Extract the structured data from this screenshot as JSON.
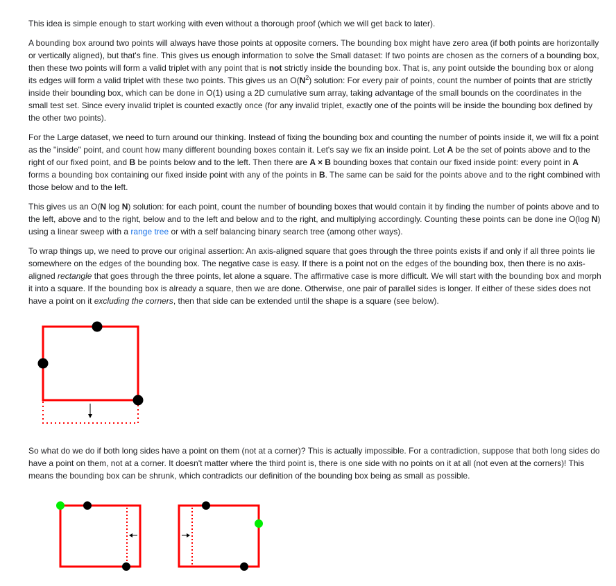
{
  "intro": "This idea is simple enough to start working with even without a thorough proof (which we will get back to later).",
  "p2": {
    "a": "A bounding box around two points will always have those points at opposite corners. The bounding box might have zero area (if both points are horizontally or vertically aligned), but that's fine. This gives us enough information to solve the Small dataset: If two points are chosen as the corners of a bounding box, then these two points will form a valid triplet with any point that is ",
    "bold_not": "not",
    "b": " strictly inside the bounding box. That is, any point outside the bounding box or along its edges will form a valid triplet with these two points. This gives us an O(",
    "bold_n": "N",
    "sup": "2",
    "c": ") solution: For every pair of points, count the number of points that are strictly inside their bounding box, which can be done in O(1) using a 2D cumulative sum array, taking advantage of the small bounds on the coordinates in the small test set. Since every invalid triplet is counted exactly once (for any invalid triplet, exactly one of the points will be inside the bounding box defined by the other two points)."
  },
  "p3": {
    "a": "For the Large dataset, we need to turn around our thinking. Instead of fixing the bounding box and counting the number of points inside it, we will fix a point as the \"inside\" point, and count how many different bounding boxes contain it. Let's say we fix an inside point. Let ",
    "A1": "A",
    "b": " be the set of points above and to the right of our fixed point, and ",
    "B1": "B",
    "c": " be points below and to the left. Then there are ",
    "AxB": "A × B",
    "d": " bounding boxes that contain our fixed inside point: every point in ",
    "A2": "A",
    "e": " forms a bounding box containing our fixed inside point with any of the points in ",
    "B2": "B",
    "f": ". The same can be said for the points above and to the right combined with those below and to the left."
  },
  "p4": {
    "a": "This gives us an O(",
    "n1": "N",
    "b": " log ",
    "n2": "N",
    "c": ") solution: for each point, count the number of bounding boxes that would contain it by finding the number of points above and to the left, above and to the right, below and to the left and below and to the right, and multiplying accordingly. Counting these points can be done ine O(log ",
    "n3": "N",
    "d": ") using a linear sweep with a ",
    "link": "range tree",
    "e": " or with a self balancing binary search tree (among other ways)."
  },
  "p5": {
    "a": "To wrap things up, we need to prove our original assertion: An axis-aligned square that goes through the three points exists if and only if all three points lie somewhere on the edges of the bounding box. The negative case is easy. If there is a point not on the edges of the bounding box, then there is no axis-aligned ",
    "rect": "rectangle",
    "b": " that goes through the three points, let alone a square. The affirmative case is more difficult. We will start with the bounding box and morph it into a square. If the bounding box is already a square, then we are done. Otherwise, one pair of parallel sides is longer. If either of these sides does not have a point on it ",
    "excl": "excluding the corners",
    "c": ", then that side can be extended until the shape is a square (see below)."
  },
  "p6": "So what do we do if both long sides have a point on them (not at a corner)? This is actually impossible. For a contradiction, suppose that both long sides do have a point on them, not at a corner. It doesn't matter where the third point is, there is one side with no points on it at all (not even at the corners)! This means the bounding box can be shrunk, which contradicts our definition of the bounding box being as small as possible.",
  "colors": {
    "box": "#ff0000",
    "point": "#000000",
    "highlight": "#00ee00",
    "link": "#1a73e8"
  }
}
